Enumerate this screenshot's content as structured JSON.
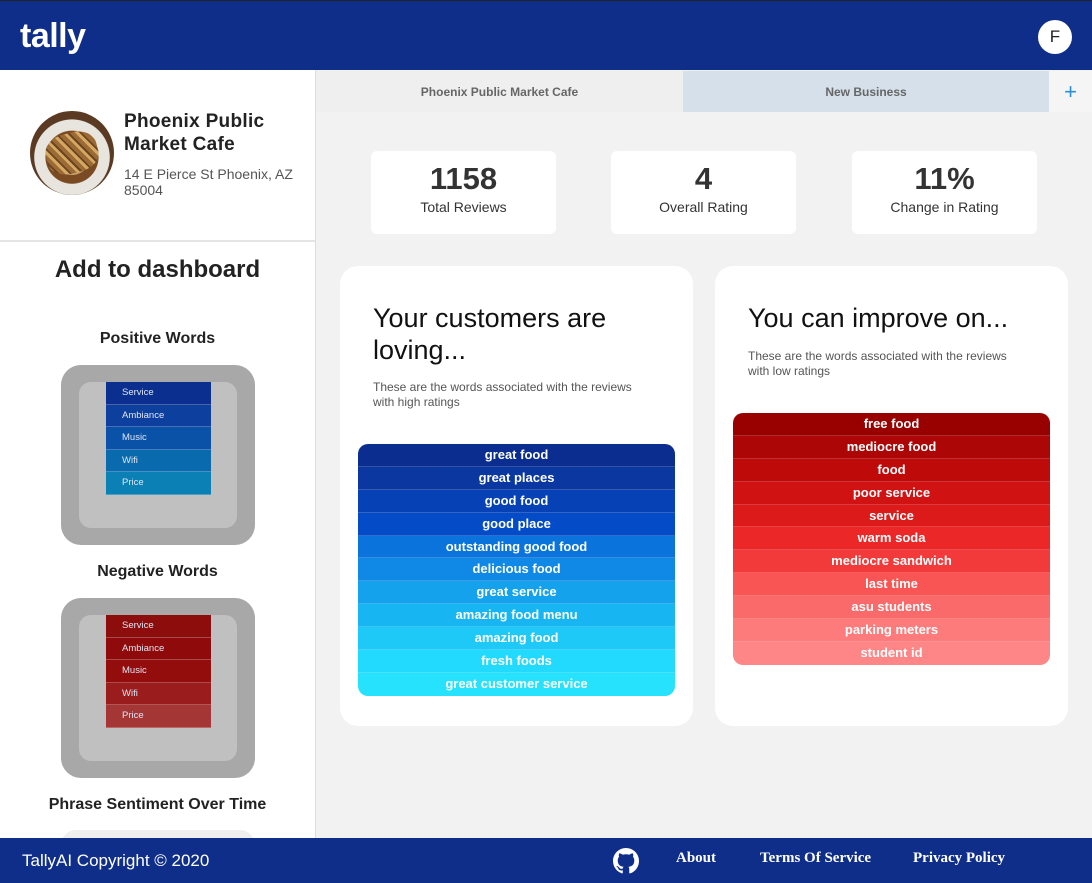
{
  "app": {
    "logo": "tally",
    "user_initial": "F"
  },
  "business": {
    "name": "Phoenix Public Market Cafe",
    "address": "14 E Pierce St Phoenix, AZ 85004"
  },
  "sidebar": {
    "add_title": "Add to dashboard",
    "widgets": [
      {
        "label": "Positive Words",
        "items": [
          "Service",
          "Ambiance",
          "Music",
          "Wifi",
          "Price"
        ],
        "colors": [
          "#0b2f8e",
          "#0d3f9e",
          "#0a52a8",
          "#0a6aae",
          "#0b80b4"
        ]
      },
      {
        "label": "Negative Words",
        "items": [
          "Service",
          "Ambiance",
          "Music",
          "Wifi",
          "Price"
        ],
        "colors": [
          "#8d0d0d",
          "#8f0b0b",
          "#940d0d",
          "#9b1c1c",
          "#a43636"
        ]
      },
      {
        "label": "Phrase Sentiment Over Time"
      }
    ]
  },
  "tabs": [
    {
      "label": "Phoenix Public Market Cafe",
      "active": true
    },
    {
      "label": "New Business",
      "active": false
    },
    {
      "label": "+"
    }
  ],
  "stats": [
    {
      "value": "1158",
      "label": "Total Reviews"
    },
    {
      "value": "4",
      "label": "Overall Rating"
    },
    {
      "value": "11%",
      "label": "Change in Rating"
    }
  ],
  "positive_panel": {
    "title": "Your customers are loving...",
    "subtitle": "These are the words associated with the reviews with high ratings",
    "words": [
      "great food",
      "great places",
      "good food",
      "good place",
      "outstanding good food",
      "delicious food",
      "great service",
      "amazing food menu",
      "amazing food",
      "fresh foods",
      "great customer service"
    ],
    "colors": [
      "#0a2d8f",
      "#0a37a0",
      "#0642b6",
      "#044cc7",
      "#0a74dc",
      "#1088e6",
      "#14a2ec",
      "#17b5f1",
      "#1ec9f8",
      "#22dafd",
      "#26e2fd"
    ]
  },
  "negative_panel": {
    "title": "You can improve on...",
    "subtitle": "These are the words associated with the reviews with low ratings",
    "words": [
      "free food",
      "mediocre food",
      "food",
      "poor service",
      "service",
      "warm soda",
      "mediocre sandwich",
      "last time",
      "asu students",
      "parking meters",
      "student id"
    ],
    "colors": [
      "#990000",
      "#ad0606",
      "#bf0a0a",
      "#d01212",
      "#dd1a1a",
      "#ec2727",
      "#f33a3a",
      "#fa5555",
      "#fb6a6a",
      "#fd7b7b",
      "#fe8686"
    ]
  },
  "footer": {
    "copyright": "TallyAI Copyright © 2020",
    "links": [
      "About",
      "Terms Of Service",
      "Privacy Policy"
    ]
  }
}
